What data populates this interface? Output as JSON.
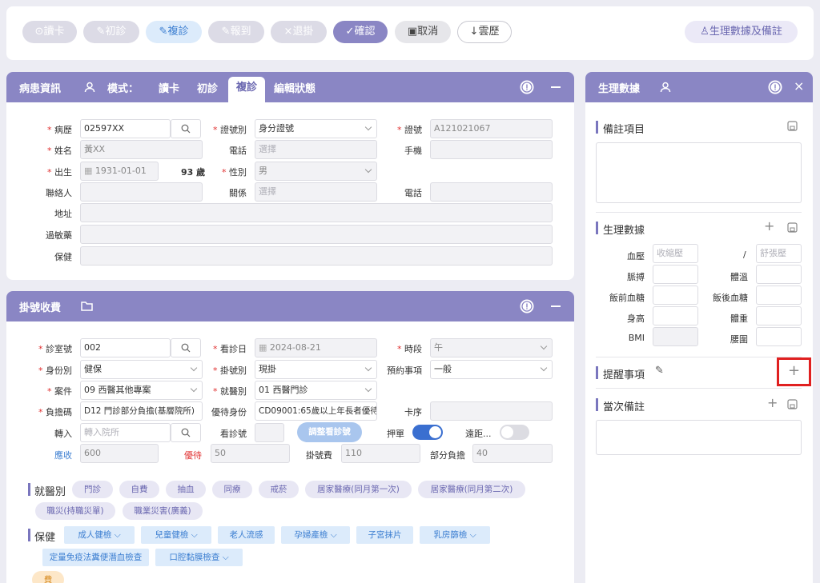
{
  "toolbar": {
    "read_card": "讀卡",
    "first_visit": "初診",
    "revisit": "複診",
    "checkin": "報到",
    "withdraw": "退掛",
    "confirm": "確認",
    "cancel": "取消",
    "cloud_history": "雲歷",
    "vitals_notes": "生理數據及備註"
  },
  "patient_panel": {
    "title": "病患資訊",
    "mode_label": "模式：",
    "tabs": [
      "讀卡",
      "初診",
      "複診",
      "編輯狀態"
    ],
    "active_tab": "複診",
    "fields": {
      "chart_no_label": "病歷",
      "chart_no": "02597XX",
      "id_type_label": "證號別",
      "id_type": "身分證號",
      "id_no_label": "證號",
      "id_no": "A121021067",
      "name_label": "姓名",
      "name": "黃XX",
      "phone_label": "電話",
      "phone_placeholder": "選擇",
      "mobile_label": "手機",
      "birth_label": "出生",
      "birth": "1931-01-01",
      "age": "93 歲",
      "gender_label": "性別",
      "gender": "男",
      "contact_label": "聯絡人",
      "relation_label": "關係",
      "relation_placeholder": "選擇",
      "contact_phone_label": "電話",
      "address_label": "地址",
      "allergy_label": "過敏藥",
      "healthcare_label": "保健"
    }
  },
  "registration_panel": {
    "title": "掛號收費",
    "fields": {
      "room_label": "診室號",
      "room": "002",
      "date_label": "看診日",
      "date": "2024-08-21",
      "period_label": "時段",
      "period": "午",
      "identity_label": "身份別",
      "identity": "健保",
      "reg_type_label": "掛號別",
      "reg_type": "現掛",
      "appt_label": "預約事項",
      "appt": "一般",
      "case_label": "案件",
      "case": "09 西醫其他專案",
      "dept_label": "就醫別",
      "dept": "01 西醫門診",
      "copay_code_label": "負擔碼",
      "copay_code": "D12 門診部分負擔(基層院所)",
      "priority_label": "優待身份",
      "priority": "CD09001:65歲以上年長者優待",
      "card_seq_label": "卡序",
      "transfer_label": "轉入",
      "transfer_placeholder": "轉入院所",
      "visit_no_label": "看診號",
      "adjust_btn": "調整看診號",
      "deposit_label": "押單",
      "remote_label": "遠距...",
      "receivable_label": "應收",
      "receivable": "600",
      "owed_label": "優待",
      "owed": "50",
      "reg_fee_label": "掛號費",
      "reg_fee": "110",
      "part_copay_label": "部分負擔",
      "part_copay": "40"
    },
    "medical_type": {
      "label": "就醫別",
      "chips": [
        "門診",
        "自費",
        "抽血",
        "同療",
        "戒菸",
        "居家醫療(同月第一次)",
        "居家醫療(同月第二次)",
        "職災(持職災單)",
        "職業災害(廣義)"
      ]
    },
    "health_check": {
      "label": "保健",
      "chips": [
        "成人健檢",
        "兒童健檢",
        "老人流感",
        "孕婦產檢",
        "子宮抹片",
        "乳房篩檢",
        "定量免疫法糞便潛血檢查",
        "口腔黏膜檢查"
      ],
      "partial": "費"
    }
  },
  "vitals_panel": {
    "title": "生理數據",
    "notes_label": "備註項目",
    "vitals_label": "生理數據",
    "bp_label": "血壓",
    "systolic_placeholder": "收縮壓",
    "slash": "/",
    "diastolic_placeholder": "舒張壓",
    "pulse_label": "脈搏",
    "temp_label": "體溫",
    "pre_meal_label": "飯前血糖",
    "post_meal_label": "飯後血糖",
    "height_label": "身高",
    "weight_label": "體重",
    "bmi_label": "BMI",
    "waist_label": "腰圍",
    "reminder_label": "提醒事項",
    "current_notes_label": "當次備註"
  },
  "colors": {
    "accent": "#8a86c4",
    "primary_blue": "#3d7fd1",
    "required": "#e03030",
    "highlight": "#e02020"
  }
}
